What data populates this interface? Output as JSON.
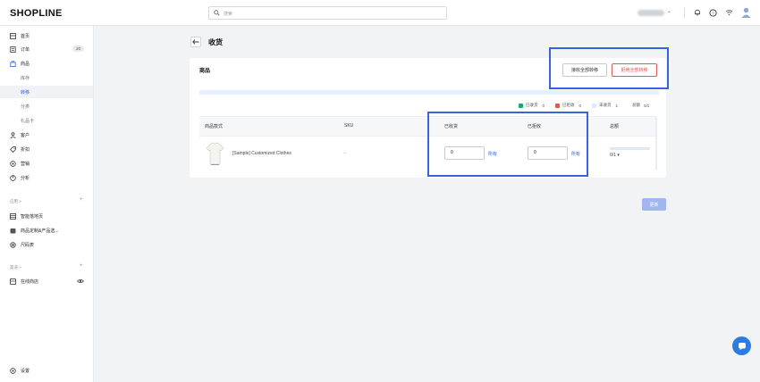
{
  "topbar": {
    "logo": "SHOPLINE",
    "search_placeholder": "搜索",
    "icons": [
      "bell-icon",
      "help-icon",
      "wifi-icon",
      "avatar-icon"
    ]
  },
  "sidebar": {
    "items": [
      {
        "label": "首页",
        "icon": "home-icon"
      },
      {
        "label": "订单",
        "icon": "order-icon",
        "badge": "20"
      },
      {
        "label": "商品",
        "icon": "bag-icon"
      },
      {
        "label": "库存"
      },
      {
        "label": "转移"
      },
      {
        "label": "分类"
      },
      {
        "label": "礼品卡"
      },
      {
        "label": "客户",
        "icon": "user-icon"
      },
      {
        "label": "折扣",
        "icon": "tag-icon"
      },
      {
        "label": "营销",
        "icon": "marketing-icon"
      },
      {
        "label": "分析",
        "icon": "analytics-icon"
      }
    ],
    "apps_section": "应用 >",
    "apps": [
      {
        "label": "智能落地页",
        "icon": "grid-icon"
      },
      {
        "label": "商品定制&产品选...",
        "icon": "store-icon"
      },
      {
        "label": "尺码表",
        "icon": "ruler-icon"
      }
    ],
    "channels_section": "渠道 >",
    "channels": [
      {
        "label": "在线商店",
        "icon": "shop-icon"
      }
    ],
    "settings": "设置"
  },
  "page": {
    "title": "收货",
    "card_title": "商品",
    "receive_all_button": "接收全部转移",
    "reject_all_button": "拒绝全部转移",
    "legend": {
      "received_label": "已收货",
      "received_count": "0",
      "rejected_label": "已拒收",
      "rejected_count": "0",
      "pending_label": "未收货",
      "pending_count": "1",
      "total_label": "总额",
      "total_value": "0/1"
    },
    "legend_colors": {
      "received": "#1aa86a",
      "rejected": "#ef5a33",
      "pending": "#dcecfb"
    },
    "table": {
      "headers": [
        "商品款式",
        "SKU",
        "已收货",
        "已拒收",
        "总额"
      ],
      "rows": [
        {
          "name": "[Sample] Customized Clothes",
          "sku": "-",
          "received": "0",
          "received_all": "所有",
          "rejected": "0",
          "rejected_all": "所有",
          "total": "0/1 ▾"
        }
      ]
    },
    "update_button": "更新"
  },
  "colors": {
    "accent": "#2b63e8",
    "highlight_box": "#3a62e0",
    "danger": "#e0584f"
  }
}
